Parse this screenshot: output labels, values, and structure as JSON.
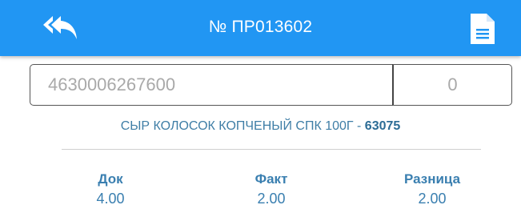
{
  "header": {
    "title": "№ ПР013602",
    "back_icon": "reply-all-icon",
    "doc_icon": "document-icon"
  },
  "inputs": {
    "barcode_placeholder": "4630006267600",
    "quantity_placeholder": "0"
  },
  "product": {
    "name": "СЫР КОЛОСОК КОПЧЕНЫЙ СПК 100Г - ",
    "code": "63075"
  },
  "stats": {
    "doc": {
      "label": "Док",
      "value": "4.00"
    },
    "fact": {
      "label": "Факт",
      "value": "2.00"
    },
    "diff": {
      "label": "Разница",
      "value": "2.00"
    }
  },
  "colors": {
    "header_bg": "#2196f3",
    "accent_text": "#3a7fb0"
  }
}
